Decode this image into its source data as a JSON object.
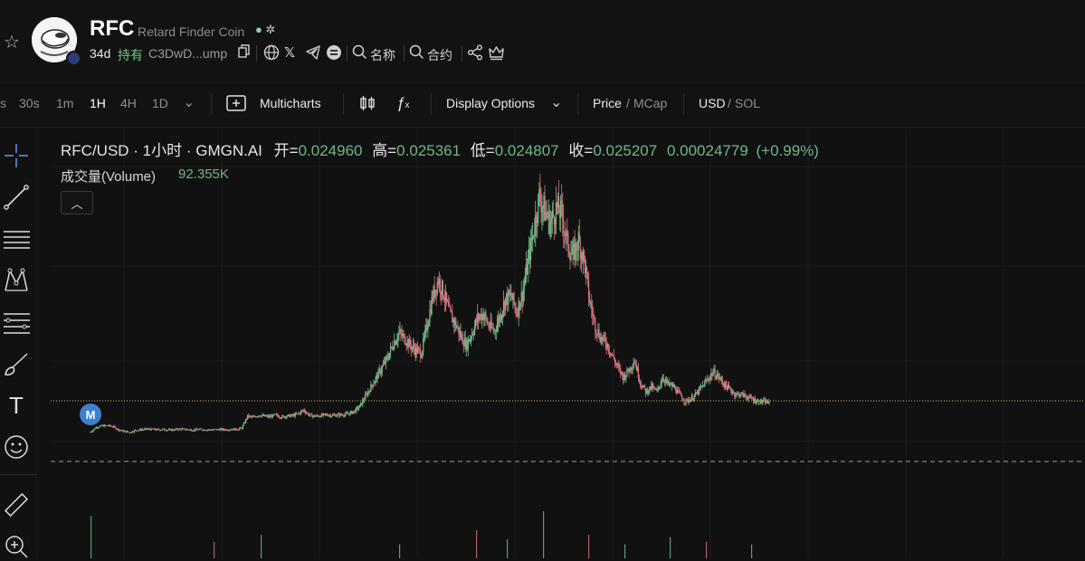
{
  "header": {
    "symbol": "RFC",
    "full_name": "Retard Finder Coin",
    "age": "34d",
    "holders_label": "持有",
    "address": "C3DwD...ump",
    "search_name_label": "名称",
    "search_contract_label": "合约",
    "icons": [
      "star-icon",
      "copy-icon",
      "globe-icon",
      "x-icon",
      "telegram-icon",
      "bar-icon",
      "search-icon",
      "share-icon",
      "crown-icon"
    ]
  },
  "toolbar": {
    "intervals": [
      "s",
      "30s",
      "1m",
      "1H",
      "4H",
      "1D"
    ],
    "active_interval": "1H",
    "multicharts_label": "Multicharts",
    "display_options_label": "Display Options",
    "price_label": "Price",
    "mcap_label": "MCap",
    "usd_label": "USD",
    "sol_label": "SOL",
    "slash": "/"
  },
  "legend": {
    "title": "RFC/USD · 1小时 · GMGN.AI",
    "open_label": "开=",
    "open": "0.024960",
    "high_label": "高=",
    "high": "0.025361",
    "low_label": "低=",
    "low": "0.024807",
    "close_label": "收=",
    "close": "0.025207",
    "change": "0.00024779",
    "change_pct": "(+0.99%)",
    "volume_label": "成交量(Volume)",
    "volume": "92.355K",
    "marker": "M"
  },
  "colors": {
    "up": "#6fbf8a",
    "down": "#d9707f",
    "background": "#111111",
    "grid": "#1c1c1c"
  },
  "chart_data": {
    "type": "line",
    "series": [
      {
        "name": "",
        "values": [
          0.35,
          0.55,
          0.6,
          0.62,
          0.58,
          0.45,
          0.38,
          0.34,
          0.42,
          0.45,
          0.47,
          0.46,
          0.45,
          0.46,
          0.44,
          0.45,
          0.48,
          0.46,
          0.44,
          0.45,
          0.46,
          0.45,
          0.44,
          0.46,
          0.45,
          0.47,
          0.46,
          0.52,
          1.0,
          0.95,
          1.05,
          1.0,
          0.98,
          1.05,
          0.97,
          1.01,
          1.02,
          1.1,
          1.25,
          1.05,
          1.0,
          1.02,
          1.06,
          1.04,
          1.05,
          1.06,
          1.1,
          1.2,
          1.4,
          1.8,
          2.2,
          2.6,
          3.0,
          3.4,
          4.0,
          4.4,
          4.2,
          3.9,
          3.7,
          3.6,
          4.7,
          5.9,
          6.6,
          6.0,
          5.2,
          4.8,
          4.3,
          3.9,
          4.4,
          5.0,
          5.2,
          4.7,
          4.5,
          5.1,
          5.8,
          5.9,
          5.3,
          6.0,
          7.3,
          8.6,
          10.0,
          9.4,
          8.9,
          9.5,
          9.3,
          8.1,
          7.5,
          8.2,
          7.4,
          5.7,
          4.7,
          4.2,
          4.0,
          3.5,
          3.0,
          2.6,
          2.9,
          3.3,
          2.4,
          2.0,
          2.2,
          2.0,
          2.6,
          2.3,
          2.2,
          1.9,
          1.6,
          1.7,
          1.9,
          2.2,
          2.5,
          2.8,
          2.6,
          2.3,
          2.1,
          1.9,
          1.9,
          1.8,
          1.7,
          1.6,
          1.6,
          1.55
        ]
      }
    ],
    "ylim": [
      0,
      10
    ],
    "grid": true,
    "legend": "none"
  },
  "volume_bars": {
    "values": [
      0.9,
      0.35,
      0.5,
      0.3,
      0.6,
      0.4,
      1.0,
      0.5,
      0.3,
      0.45,
      0.35,
      0.3
    ]
  }
}
